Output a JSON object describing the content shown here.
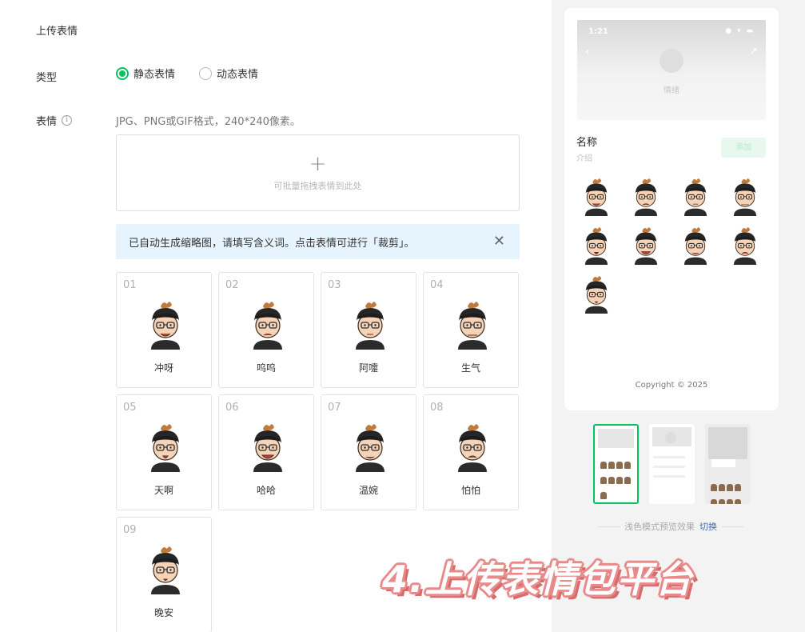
{
  "form": {
    "section_title": "上传表情",
    "type_label": "类型",
    "type_options": [
      {
        "label": "静态表情",
        "checked": true
      },
      {
        "label": "动态表情",
        "checked": false
      }
    ],
    "sticker_label": "表情",
    "info_icon": "ⓘ",
    "format_hint": "JPG、PNG或GIF格式，240*240像素。",
    "dropzone_text": "可批量拖拽表情到此处",
    "dropzone_plus": "+",
    "notice_text": "已自动生成缩略图，请填写含义词。点击表情可进行「裁剪」。",
    "notice_close": "✕"
  },
  "stickers": [
    {
      "num": "01",
      "label": "冲呀"
    },
    {
      "num": "02",
      "label": "呜呜"
    },
    {
      "num": "03",
      "label": "阿嚏"
    },
    {
      "num": "04",
      "label": "生气"
    },
    {
      "num": "05",
      "label": "天啊"
    },
    {
      "num": "06",
      "label": "哈哈"
    },
    {
      "num": "07",
      "label": "温婉"
    },
    {
      "num": "08",
      "label": "怕怕"
    },
    {
      "num": "09",
      "label": "晚安"
    }
  ],
  "preview": {
    "status_time": "1:21",
    "status_icons": "● ▾ ▬",
    "nav_back": "‹",
    "nav_share": "↗",
    "avatar_name": "情绪",
    "name": "名称",
    "intro": "介绍",
    "add_button": "添加",
    "copyright": "Copyright © 2025"
  },
  "theme_switch": {
    "text": "浅色模式预览效果",
    "link": "切换"
  },
  "overlay_caption": "4.上传表情包平台",
  "colors": {
    "accent": "#07c160",
    "notice_bg": "#e6f4fd",
    "caption_outline": "#e98a8a"
  }
}
